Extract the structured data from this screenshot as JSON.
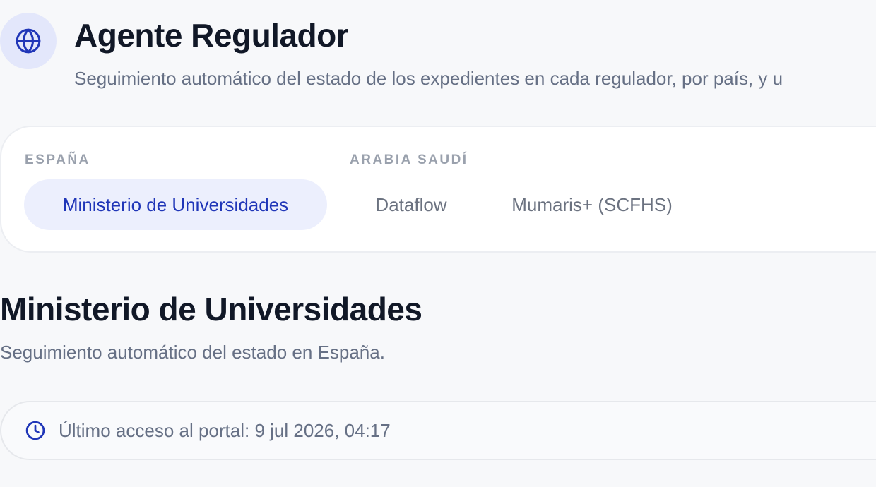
{
  "header": {
    "icon": "globe-icon",
    "title": "Agente Regulador",
    "subtitle": "Seguimiento automático del estado de los expedientes en cada regulador, por país, y u"
  },
  "regulators": {
    "groups": [
      {
        "country": "ESPAÑA",
        "tabs": [
          {
            "label": "Ministerio de Universidades",
            "active": true
          }
        ]
      },
      {
        "country": "ARABIA SAUDÍ",
        "tabs": [
          {
            "label": "Dataflow",
            "active": false
          },
          {
            "label": "Mumaris+ (SCFHS)",
            "active": false
          }
        ]
      }
    ]
  },
  "section": {
    "title": "Ministerio de Universidades",
    "subtitle": "Seguimiento automático del estado en España."
  },
  "last_access": {
    "icon": "clock-icon",
    "text": "Último acceso al portal: 9 jul 2026, 04:17"
  },
  "colors": {
    "accent": "#2036b8",
    "accent_bg": "#eceffd",
    "icon_bg": "#e3e7fb",
    "muted_text": "#667085",
    "page_bg": "#f7f8fa"
  }
}
